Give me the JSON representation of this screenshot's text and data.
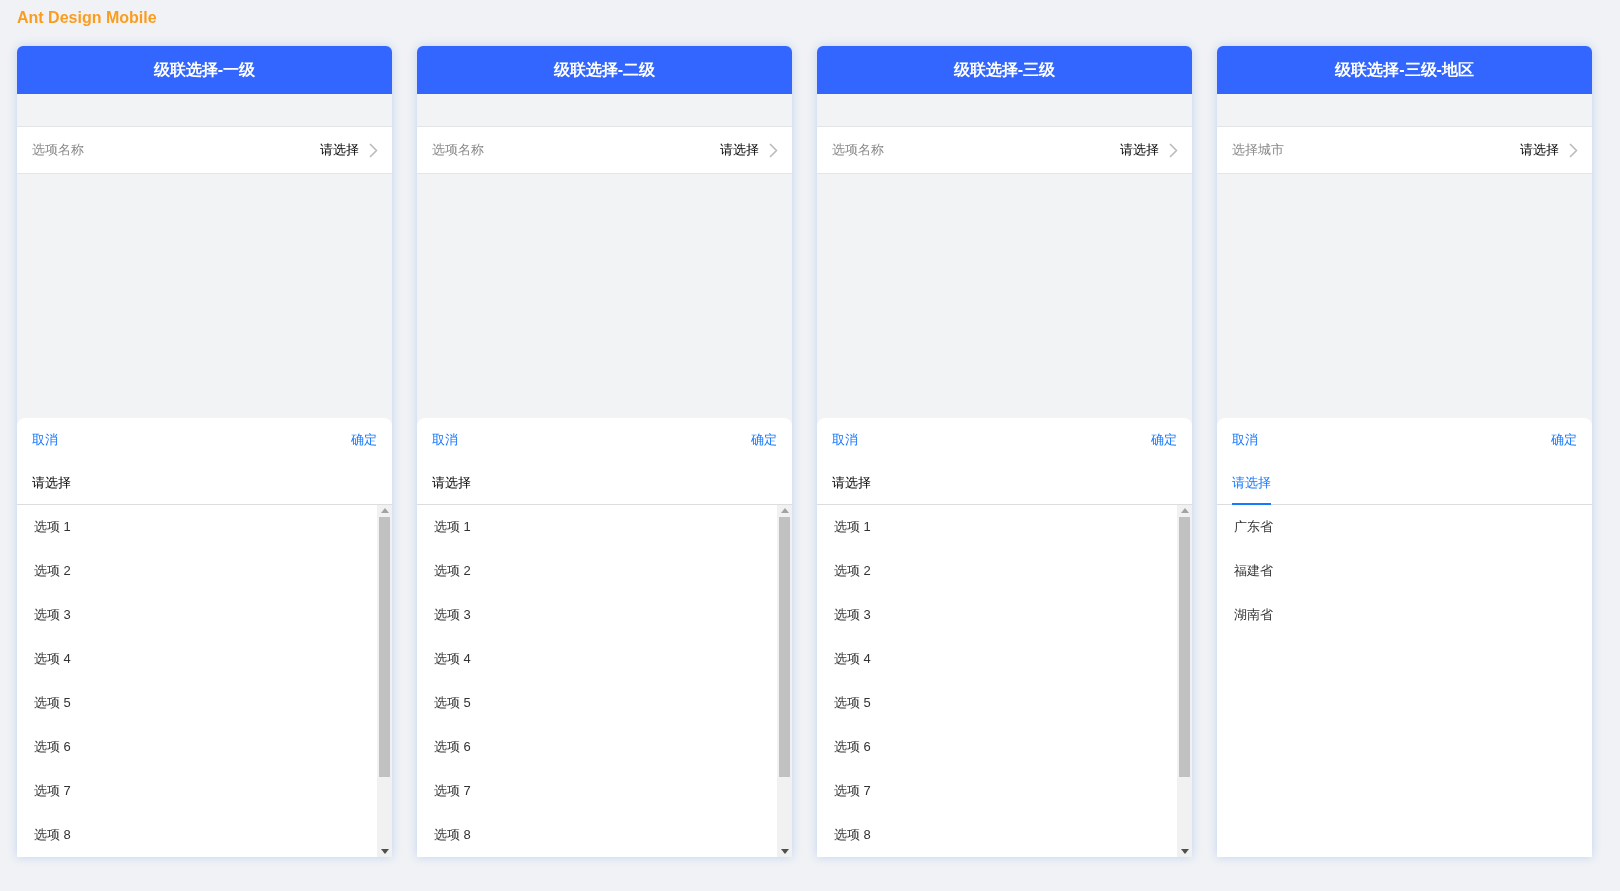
{
  "brand": "Ant Design Mobile",
  "cards": [
    {
      "title": "级联选择-一级",
      "field": {
        "label": "选项名称",
        "value": "请选择"
      },
      "cancel": "取消",
      "confirm": "确定",
      "tabs": [
        {
          "label": "请选择",
          "selected": false
        }
      ],
      "scrollbar": true,
      "options": [
        "选项 1",
        "选项 2",
        "选项 3",
        "选项 4",
        "选项 5",
        "选项 6",
        "选项 7",
        "选项 8"
      ]
    },
    {
      "title": "级联选择-二级",
      "field": {
        "label": "选项名称",
        "value": "请选择"
      },
      "cancel": "取消",
      "confirm": "确定",
      "tabs": [
        {
          "label": "请选择",
          "selected": false
        }
      ],
      "scrollbar": true,
      "options": [
        "选项 1",
        "选项 2",
        "选项 3",
        "选项 4",
        "选项 5",
        "选项 6",
        "选项 7",
        "选项 8"
      ]
    },
    {
      "title": "级联选择-三级",
      "field": {
        "label": "选项名称",
        "value": "请选择"
      },
      "cancel": "取消",
      "confirm": "确定",
      "tabs": [
        {
          "label": "请选择",
          "selected": false
        }
      ],
      "scrollbar": true,
      "options": [
        "选项 1",
        "选项 2",
        "选项 3",
        "选项 4",
        "选项 5",
        "选项 6",
        "选项 7",
        "选项 8"
      ]
    },
    {
      "title": "级联选择-三级-地区",
      "field": {
        "label": "选择城市",
        "value": "请选择"
      },
      "cancel": "取消",
      "confirm": "确定",
      "tabs": [
        {
          "label": "请选择",
          "selected": true
        }
      ],
      "scrollbar": false,
      "options": [
        "广东省",
        "福建省",
        "湖南省"
      ]
    }
  ]
}
